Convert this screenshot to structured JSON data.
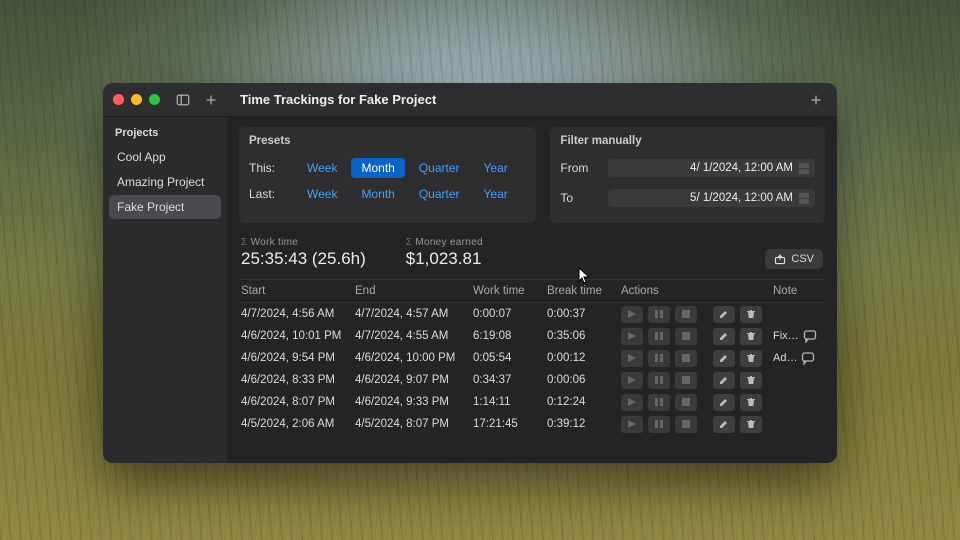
{
  "window": {
    "title": "Time Trackings for Fake Project"
  },
  "sidebar": {
    "header": "Projects",
    "items": [
      {
        "label": "Cool App",
        "selected": false
      },
      {
        "label": "Amazing Project",
        "selected": false
      },
      {
        "label": "Fake Project",
        "selected": true
      }
    ]
  },
  "presets": {
    "title": "Presets",
    "this_label": "This:",
    "last_label": "Last:",
    "ranges": [
      "Week",
      "Month",
      "Quarter",
      "Year"
    ],
    "this_selected": "Month",
    "last_selected": null
  },
  "filter": {
    "title": "Filter manually",
    "from_label": "From",
    "to_label": "To",
    "from_value": "4/  1/2024, 12:00 AM",
    "to_value": "5/  1/2024, 12:00 AM"
  },
  "summary": {
    "work_label": "Work time",
    "work_value": "25:35:43 (25.6h)",
    "money_label": "Money earned",
    "money_value": "$1,023.81",
    "csv_label": "CSV"
  },
  "table": {
    "columns": {
      "start": "Start",
      "end": "End",
      "work": "Work time",
      "break": "Break time",
      "actions": "Actions",
      "note": "Note"
    },
    "rows": [
      {
        "start": "4/7/2024, 4:56 AM",
        "end": "4/7/2024, 4:57 AM",
        "work": "0:00:07",
        "break": "0:00:37",
        "note": ""
      },
      {
        "start": "4/6/2024, 10:01 PM",
        "end": "4/7/2024, 4:55 AM",
        "work": "6:19:08",
        "break": "0:35:06",
        "note": "Fix…"
      },
      {
        "start": "4/6/2024, 9:54 PM",
        "end": "4/6/2024, 10:00 PM",
        "work": "0:05:54",
        "break": "0:00:12",
        "note": "Ad…"
      },
      {
        "start": "4/6/2024, 8:33 PM",
        "end": "4/6/2024, 9:07 PM",
        "work": "0:34:37",
        "break": "0:00:06",
        "note": ""
      },
      {
        "start": "4/6/2024, 8:07 PM",
        "end": "4/6/2024, 9:33 PM",
        "work": "1:14:11",
        "break": "0:12:24",
        "note": ""
      },
      {
        "start": "4/5/2024, 2:06 AM",
        "end": "4/5/2024, 8:07 PM",
        "work": "17:21:45",
        "break": "0:39:12",
        "note": ""
      }
    ]
  }
}
